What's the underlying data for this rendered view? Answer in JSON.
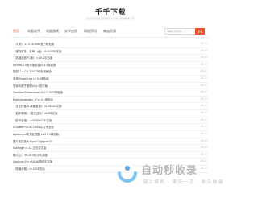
{
  "site": {
    "title": "千千下载",
    "subtitle": "提供最新最全的免费软件下载，绿色软件下载"
  },
  "nav": {
    "items": [
      {
        "label": "首页",
        "active": true
      },
      {
        "label": "电脑软件",
        "active": false
      },
      {
        "label": "电脑游戏",
        "active": false
      },
      {
        "label": "安卓应用",
        "active": false
      },
      {
        "label": "网络资讯",
        "active": false
      },
      {
        "label": "商店资源",
        "active": false
      }
    ],
    "search_placeholder": "请输入关键词",
    "search_button": "搜索"
  },
  "list": [
    {
      "title": "《人类》 v1.3.26.2968官方绿色版",
      "date": "06-30"
    },
    {
      "title": "《增效软件：安卓一级》 v1.0.2.4中文版",
      "date": "06-30"
    },
    {
      "title": "《机械迷宫PC版》 v1.5.2中文版",
      "date": "06-30"
    },
    {
      "title": "NVMe6.0.0安全免安装v1.5.0绿色版",
      "date": "06-30"
    },
    {
      "title": "猫猫11 v12.1.9.2673绿色破解版",
      "date": "06-30"
    },
    {
      "title": "安卓Simple Live v1.5.8绿色版",
      "date": "06-30"
    },
    {
      "title": "安卓大帽子管理v3.6.3官方版",
      "date": "06-30"
    },
    {
      "title": "TreeSize Professional v9.0.2.1533绿色版",
      "date": "06-30"
    },
    {
      "title": "RobiDownloader_H v4.0.1绿色版",
      "date": "06-30"
    },
    {
      "title": "《无名侠客传 原画重返》 v1.05.1中文版",
      "date": "06-30"
    },
    {
      "title": "《抽卡英雄》（俄式战役）v1.0中文版",
      "date": "06-30"
    },
    {
      "title": "《影炉会馆》 v20250627中文版",
      "date": "06-30"
    },
    {
      "title": "CCleaner v6.36.11508中文专业版",
      "date": "06-30"
    },
    {
      "title": "Apowersoft文档处理器 v1.2.0.0绿色版",
      "date": "06-30"
    },
    {
      "title": "图片无损放大Topaz Gigapixel AI",
      "date": "06-30"
    },
    {
      "title": "StarEdge v7.14 正式中文版",
      "date": "06-30"
    },
    {
      "title": "格式工厂 v5.20.0官方中文版",
      "date": "06-30"
    },
    {
      "title": "VueScan Pro v9.8.46绿色中文版",
      "date": "06-30"
    },
    {
      "title": "《特洛伊城》v1.0.0中文版",
      "date": "06-30"
    }
  ],
  "watermark": {
    "title": "自动秒收录",
    "slogan": "做上排名  ·  来访一次  ·  永久收录"
  },
  "colors": {
    "accent": "#e8542c",
    "watermark_icon": "#7ec4f0",
    "watermark_icon_dark": "#5aa7de"
  }
}
